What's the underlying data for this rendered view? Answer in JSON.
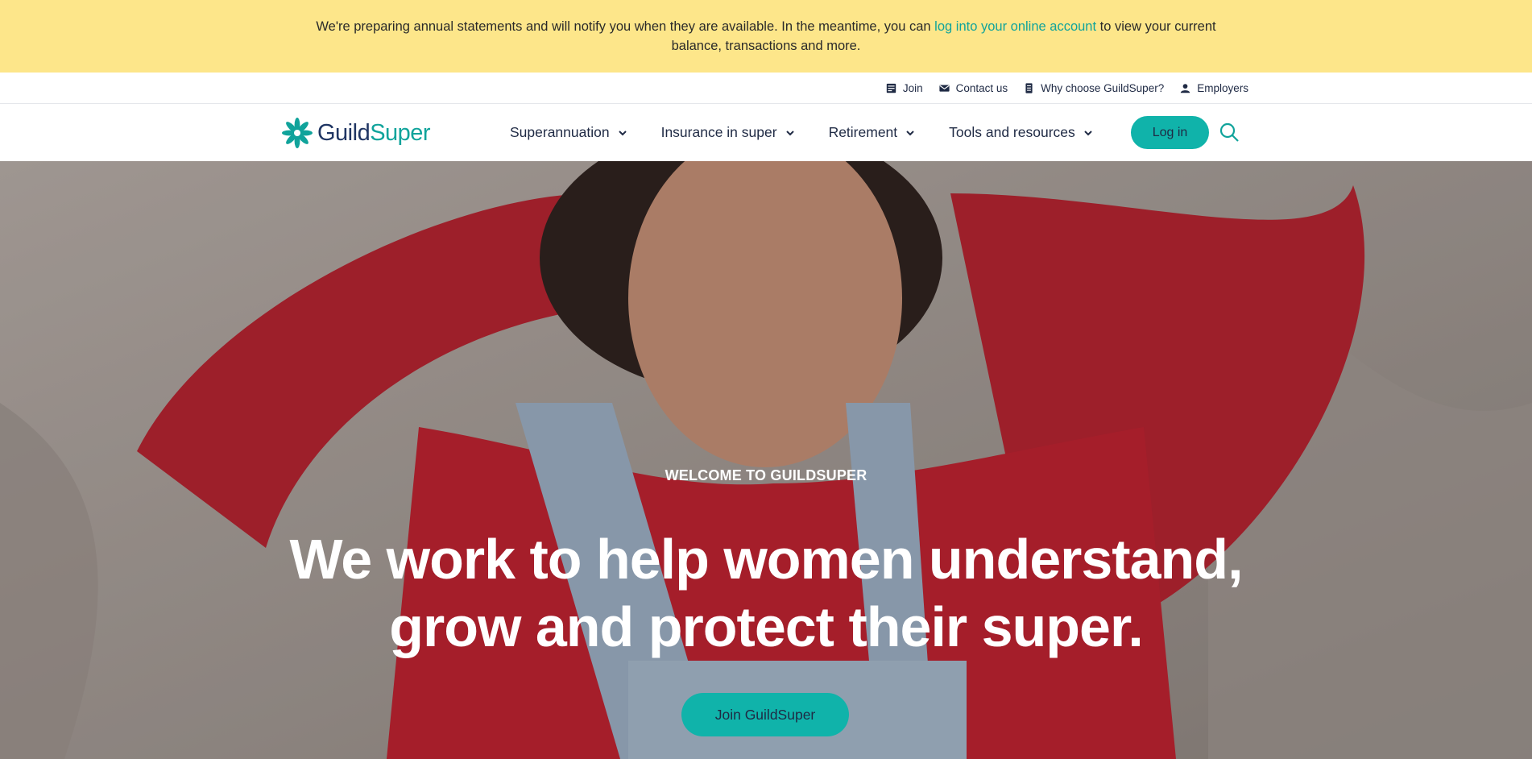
{
  "banner": {
    "text_before": "We're preparing annual statements and will notify you when they are available. In the meantime, you can ",
    "link": "log into your online account",
    "text_after": " to view your current balance, transactions and more."
  },
  "utility_nav": [
    {
      "label": "Join",
      "icon": "form-icon"
    },
    {
      "label": "Contact us",
      "icon": "envelope-icon"
    },
    {
      "label": "Why choose GuildSuper?",
      "icon": "document-icon"
    },
    {
      "label": "Employers",
      "icon": "person-icon"
    }
  ],
  "logo": {
    "part1": "Guild",
    "part2": "Super",
    "icon": "flower-logo-icon"
  },
  "main_nav": [
    {
      "label": "Superannuation"
    },
    {
      "label": "Insurance in super"
    },
    {
      "label": "Retirement"
    },
    {
      "label": "Tools and resources"
    }
  ],
  "login_label": "Log in",
  "search_icon": "search-icon",
  "hero": {
    "eyebrow": "WELCOME TO GUILDSUPER",
    "headline": "We work to help women understand, grow and protect their super.",
    "cta": "Join GuildSuper"
  },
  "colors": {
    "banner_bg": "#fde68a",
    "brand_teal": "#10b3aa",
    "brand_navy": "#1f3563",
    "link": "#10a39b"
  }
}
